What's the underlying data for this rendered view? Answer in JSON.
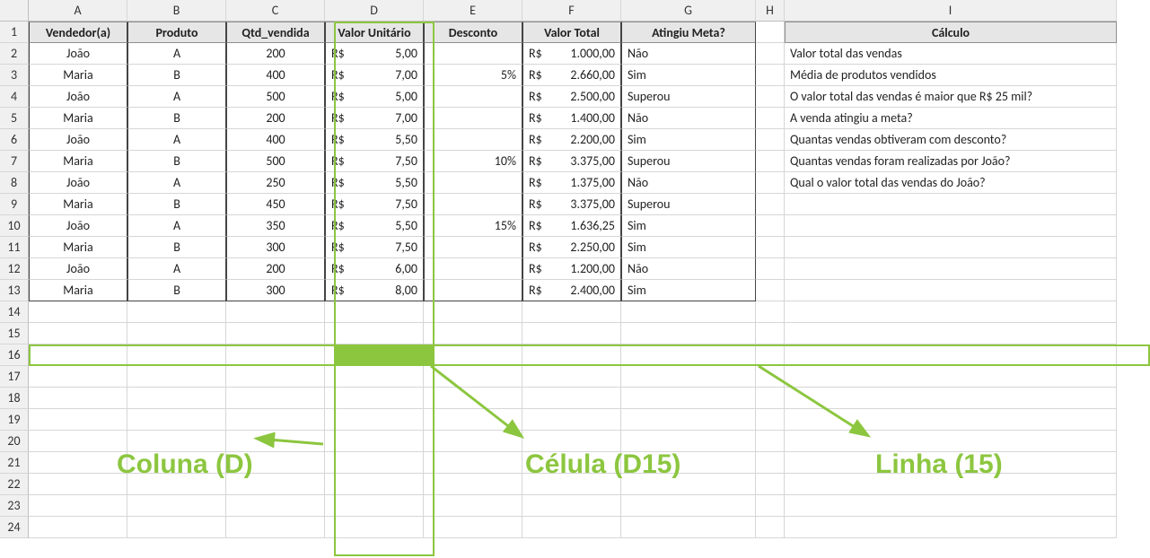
{
  "columns": [
    "A",
    "B",
    "C",
    "D",
    "E",
    "F",
    "G",
    "H",
    "I"
  ],
  "row_numbers": [
    1,
    2,
    3,
    4,
    5,
    6,
    7,
    8,
    9,
    10,
    11,
    12,
    13,
    14,
    15,
    16,
    17,
    18,
    19,
    20,
    21,
    22,
    23,
    24
  ],
  "headers": {
    "A": "Vendedor(a)",
    "B": "Produto",
    "C": "Qtd_vendida",
    "D": "Valor Unitário",
    "E": "Desconto",
    "F": "Valor Total",
    "G": "Atingiu Meta?",
    "I": "Cálculo"
  },
  "rows": [
    {
      "A": "João",
      "B": "A",
      "C": "200",
      "D": "5,00",
      "E": "",
      "F": "1.000,00",
      "G": "Não",
      "I": "Valor total das vendas"
    },
    {
      "A": "Maria",
      "B": "B",
      "C": "400",
      "D": "7,00",
      "E": "5%",
      "F": "2.660,00",
      "G": "Sim",
      "I": "Média de produtos vendidos"
    },
    {
      "A": "João",
      "B": "A",
      "C": "500",
      "D": "5,00",
      "E": "",
      "F": "2.500,00",
      "G": "Superou",
      "I": "O valor total das vendas é maior que R$ 25 mil?"
    },
    {
      "A": "Maria",
      "B": "B",
      "C": "200",
      "D": "7,00",
      "E": "",
      "F": "1.400,00",
      "G": "Não",
      "I": "A venda atingiu a meta?"
    },
    {
      "A": "João",
      "B": "A",
      "C": "400",
      "D": "5,50",
      "E": "",
      "F": "2.200,00",
      "G": "Sim",
      "I": "Quantas vendas obtiveram com desconto?"
    },
    {
      "A": "Maria",
      "B": "B",
      "C": "500",
      "D": "7,50",
      "E": "10%",
      "F": "3.375,00",
      "G": "Superou",
      "I": "Quantas vendas foram realizadas por João?"
    },
    {
      "A": "João",
      "B": "A",
      "C": "250",
      "D": "5,50",
      "E": "",
      "F": "1.375,00",
      "G": "Não",
      "I": "Qual o valor total das vendas do João?"
    },
    {
      "A": "Maria",
      "B": "B",
      "C": "450",
      "D": "7,50",
      "E": "",
      "F": "3.375,00",
      "G": "Superou",
      "I": ""
    },
    {
      "A": "João",
      "B": "A",
      "C": "350",
      "D": "5,50",
      "E": "15%",
      "F": "1.636,25",
      "G": "Sim",
      "I": ""
    },
    {
      "A": "Maria",
      "B": "B",
      "C": "300",
      "D": "7,50",
      "E": "",
      "F": "2.250,00",
      "G": "Sim",
      "I": ""
    },
    {
      "A": "João",
      "B": "A",
      "C": "200",
      "D": "6,00",
      "E": "",
      "F": "1.200,00",
      "G": "Não",
      "I": ""
    },
    {
      "A": "Maria",
      "B": "B",
      "C": "300",
      "D": "8,00",
      "E": "",
      "F": "2.400,00",
      "G": "Sim",
      "I": ""
    }
  ],
  "currency_symbol": "R$",
  "annotations": {
    "coluna_label": "Coluna (D)",
    "celula_label": "Célula (D15)",
    "linha_label": "Linha (15)"
  },
  "chart_data": {
    "type": "table",
    "title": "Planilha de vendas com anotações de Coluna, Linha e Célula",
    "columns": [
      "Vendedor(a)",
      "Produto",
      "Qtd_vendida",
      "Valor Unitário",
      "Desconto",
      "Valor Total",
      "Atingiu Meta?",
      "Cálculo"
    ],
    "data": [
      [
        "João",
        "A",
        200,
        "R$ 5,00",
        "",
        "R$ 1.000,00",
        "Não",
        "Valor total das vendas"
      ],
      [
        "Maria",
        "B",
        400,
        "R$ 7,00",
        "5%",
        "R$ 2.660,00",
        "Sim",
        "Média de produtos vendidos"
      ],
      [
        "João",
        "A",
        500,
        "R$ 5,00",
        "",
        "R$ 2.500,00",
        "Superou",
        "O valor total das vendas é maior que R$ 25 mil?"
      ],
      [
        "Maria",
        "B",
        200,
        "R$ 7,00",
        "",
        "R$ 1.400,00",
        "Não",
        "A venda atingiu a meta?"
      ],
      [
        "João",
        "A",
        400,
        "R$ 5,50",
        "",
        "R$ 2.200,00",
        "Sim",
        "Quantas vendas obtiveram com desconto?"
      ],
      [
        "Maria",
        "B",
        500,
        "R$ 7,50",
        "10%",
        "R$ 3.375,00",
        "Superou",
        "Quantas vendas foram realizadas por João?"
      ],
      [
        "João",
        "A",
        250,
        "R$ 5,50",
        "",
        "R$ 1.375,00",
        "Não",
        "Qual o valor total das vendas do João?"
      ],
      [
        "Maria",
        "B",
        450,
        "R$ 7,50",
        "",
        "R$ 3.375,00",
        "Superou",
        ""
      ],
      [
        "João",
        "A",
        350,
        "R$ 5,50",
        "15%",
        "R$ 1.636,25",
        "Sim",
        ""
      ],
      [
        "Maria",
        "B",
        300,
        "R$ 7,50",
        "",
        "R$ 2.250,00",
        "Sim",
        ""
      ],
      [
        "João",
        "A",
        200,
        "R$ 6,00",
        "",
        "R$ 1.200,00",
        "Não",
        ""
      ],
      [
        "Maria",
        "B",
        300,
        "R$ 8,00",
        "",
        "R$ 2.400,00",
        "Sim",
        ""
      ]
    ],
    "highlight": {
      "cell": "D15",
      "column": "D",
      "row": 15
    }
  }
}
